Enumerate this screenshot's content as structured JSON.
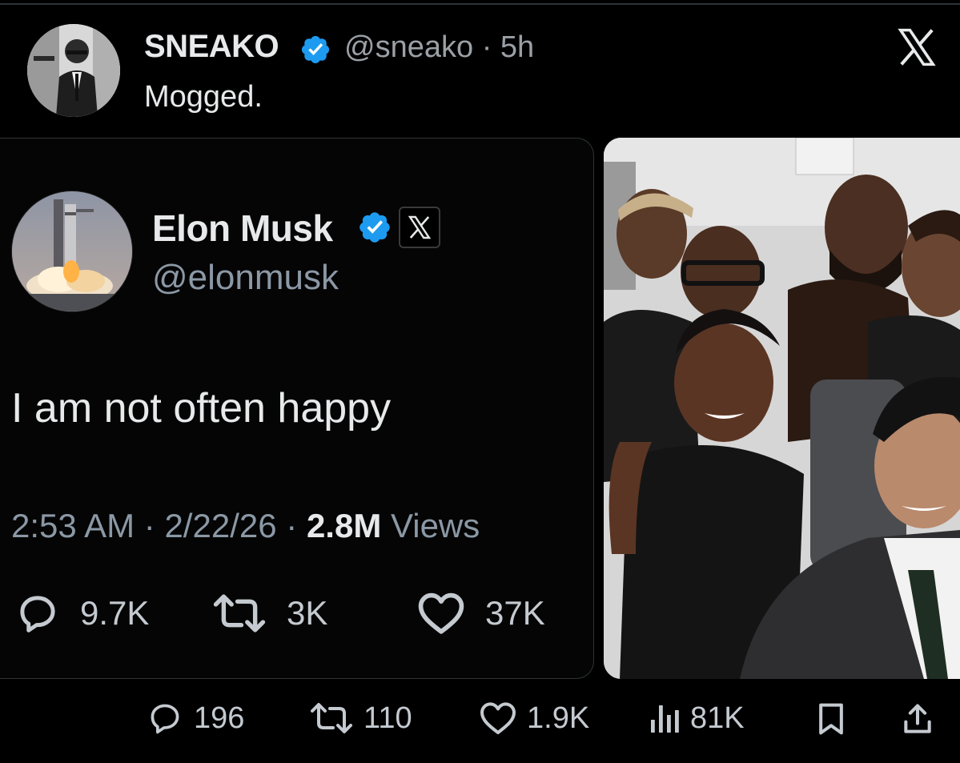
{
  "post": {
    "author_name": "SNEAKO",
    "handle": "@sneako",
    "separator": "·",
    "time": "5h",
    "text": "Mogged."
  },
  "quoted": {
    "author_name": "Elon Musk",
    "handle": "@elonmusk",
    "text": "I am not often happy",
    "time": "2:53 AM",
    "date": "2/22/26",
    "separator": "·",
    "views_count": "2.8M",
    "views_label": "Views",
    "replies": "9.7K",
    "reposts": "3K",
    "likes": "37K"
  },
  "actions": {
    "replies": "196",
    "reposts": "110",
    "likes": "1.9K",
    "views": "81K"
  },
  "colors": {
    "background": "#000000",
    "text": "#e7e9ea",
    "muted": "#8b98a5",
    "verified": "#1d9bf0"
  },
  "icons": [
    "verified-badge-icon",
    "x-logo-icon",
    "reply-icon",
    "repost-icon",
    "like-icon",
    "views-icon",
    "bookmark-icon",
    "share-icon"
  ]
}
